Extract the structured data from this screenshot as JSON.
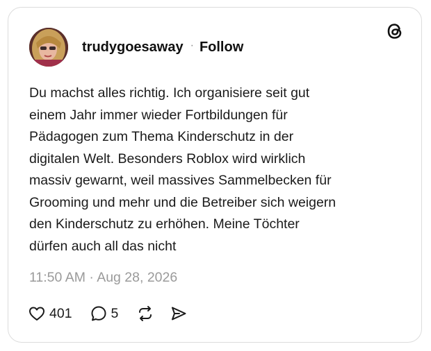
{
  "post": {
    "author": {
      "username": "trudygoesaway",
      "separator": "·",
      "follow_label": "Follow",
      "avatar_icon": "avatar-photo"
    },
    "text": "Du machst alles richtig. Ich organisiere seit gut\neinem Jahr immer wieder Fortbildungen für\nPädagogen zum Thema Kinderschutz in der\ndigitalen Welt. Besonders Roblox wird wirklich\nmassiv gewarnt, weil massives Sammelbecken für\nGrooming und mehr und die Betreiber sich weigern\nden Kinderschutz zu erhöhen. Meine Töchter\ndürfen auch all das nicht",
    "timestamp": "11:50 AM · Aug 28, 2026",
    "stats": {
      "likes": "401",
      "replies": "5"
    }
  },
  "icons": {
    "brand": "threads-logo-icon",
    "like": "heart-icon",
    "reply": "comment-bubble-icon",
    "repost": "repost-icon",
    "share": "send-icon"
  },
  "colors": {
    "text_primary": "#101010",
    "text_secondary": "#9a9a9a",
    "border": "#dcdcdc",
    "background": "#ffffff"
  }
}
